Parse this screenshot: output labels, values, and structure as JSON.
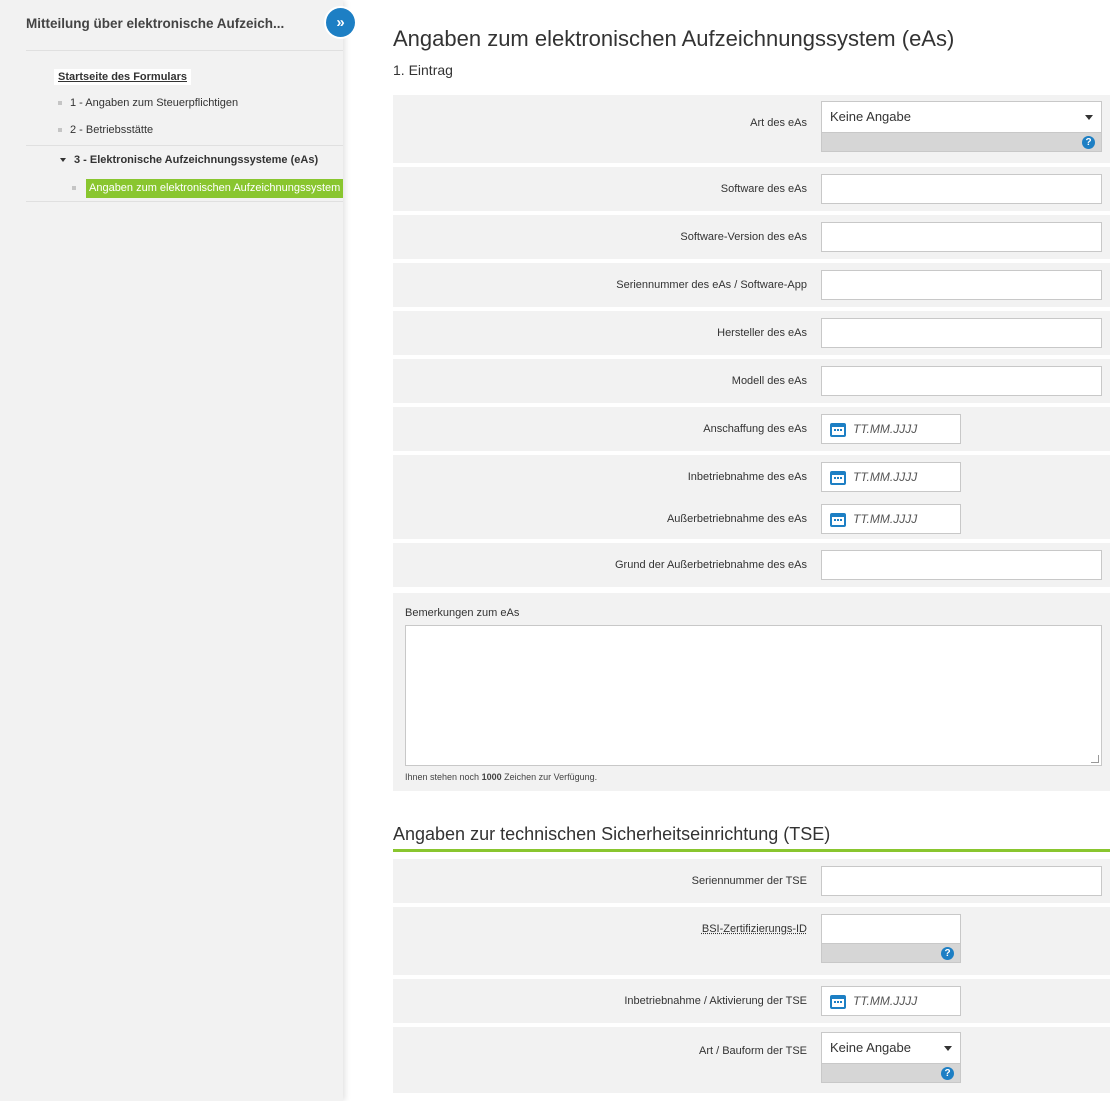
{
  "sidebar": {
    "title": "Mitteilung über elektronische Aufzeich...",
    "toggle_icon": "double-chevron-right-icon",
    "start_link": "Startseite des Formulars",
    "items": [
      {
        "label": "1 - Angaben zum Steuerpflichtigen"
      },
      {
        "label": "2 - Betriebsstätte"
      },
      {
        "label": "3 - Elektronische Aufzeichnungssysteme (eAs)"
      },
      {
        "label": "Angaben zum elektronischen Aufzeichnungssystem (eAs)"
      }
    ],
    "active_color": "#89c62f"
  },
  "main": {
    "title": "Angaben zum elektronischen Aufzeichnungssystem (eAs)",
    "entry": "1. Eintrag",
    "fields": {
      "art_label": "Art des eAs",
      "art_value": "Keine Angabe",
      "software_label": "Software des eAs",
      "version_label": "Software-Version des eAs",
      "serial_label": "Seriennummer des eAs / Software-App",
      "manufacturer_label": "Hersteller des eAs",
      "model_label": "Modell des eAs",
      "acquisition_label": "Anschaffung des eAs",
      "commissioning_label": "Inbetriebnahme des eAs",
      "decommissioning_label": "Außerbetriebnahme des eAs",
      "reason_label": "Grund der Außerbetriebnahme des eAs"
    },
    "date_placeholder": "TT.MM.JJJJ",
    "remarks": {
      "label": "Bemerkungen zum eAs",
      "hint_prefix": "Ihnen stehen noch",
      "hint_count": "1000",
      "hint_suffix": "Zeichen zur Verfügung."
    }
  },
  "tse": {
    "title": "Angaben zur technischen Sicherheitseinrichtung (TSE)",
    "serial_label": "Seriennummer der TSE",
    "bsi_label": "BSI-Zertifizierungs-ID",
    "activation_label": "Inbetriebnahme / Aktivierung der TSE",
    "type_label": "Art / Bauform der TSE",
    "type_value": "Keine Angabe"
  },
  "colors": {
    "accent_blue": "#1d7fc4",
    "accent_green": "#89c62f"
  }
}
